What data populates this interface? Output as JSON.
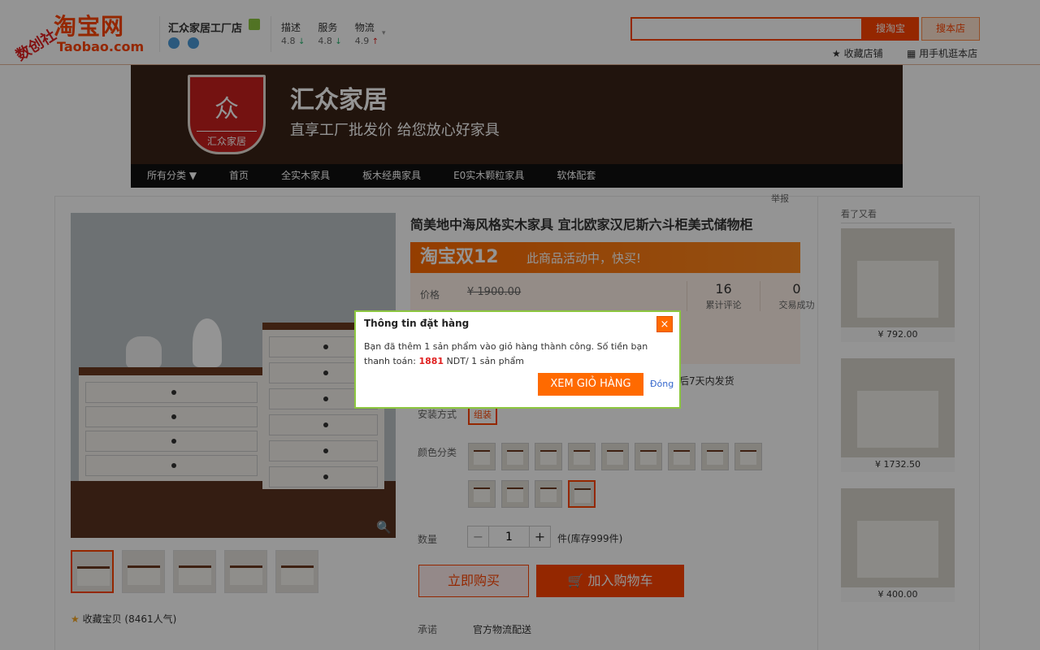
{
  "topbar": {
    "logo_cn": "淘宝网",
    "logo_en": "Taobao.com",
    "stamp": "数创社",
    "shop_name": "汇众家居工厂店",
    "ratings": [
      {
        "label": "描述",
        "value": "4.8",
        "trend": "↓"
      },
      {
        "label": "服务",
        "value": "4.8",
        "trend": "↓"
      },
      {
        "label": "物流",
        "value": "4.9",
        "trend": "↑"
      }
    ],
    "search_value": "",
    "search_button": "搜淘宝",
    "shop_search_button": "搜本店",
    "favorite_shop": "收藏店铺",
    "mobile_shop": "用手机逛本店"
  },
  "banner": {
    "logo_text": "汇众家居",
    "title": "汇众家居",
    "subtitle": "直享工厂批发价 给您放心好家具"
  },
  "nav": {
    "items": [
      "所有分类 ▼",
      "首页",
      "全实木家具",
      "板木经典家具",
      "E0实木颗粒家具",
      "软体配套"
    ]
  },
  "product": {
    "report": "举报",
    "title": "简美地中海风格实木家具 宜北欧家汉尼斯六斗柜美式储物柜",
    "promo_big": "淘宝双12",
    "promo_small": "此商品活动中，快买!",
    "price_label": "价格",
    "price_value": "¥ 1900.00",
    "stats": [
      {
        "num": "16",
        "label": "累计评论"
      },
      {
        "num": "0",
        "label": "交易成功"
      }
    ],
    "ship_text": "后7天内发货",
    "install_label": "安装方式",
    "install_option": "组装",
    "color_label": "颜色分类",
    "qty_label": "数量",
    "qty_value": "1",
    "stock": "件(库存999件)",
    "buy_now": "立即购买",
    "add_cart": "加入购物车",
    "collect": "收藏宝贝 (8461人气)",
    "promise_label": "承诺",
    "promise_value": "官方物流配送"
  },
  "sidebar": {
    "title": "看了又看",
    "items": [
      {
        "price": "¥ 792.00"
      },
      {
        "price": "¥ 1732.50"
      },
      {
        "price": "¥ 400.00"
      }
    ]
  },
  "dialog": {
    "title": "Thông tin đặt hàng",
    "close_glyph": "×",
    "message_prefix": "Bạn đã thêm 1 sản phẩm vào giỏ hàng thành công. Số tiền bạn thanh toán: ",
    "amount": "1881",
    "message_suffix": " NDT/ 1 sản phẩm",
    "view_cart": "XEM GIỎ HÀNG",
    "close_text": "Đóng"
  }
}
